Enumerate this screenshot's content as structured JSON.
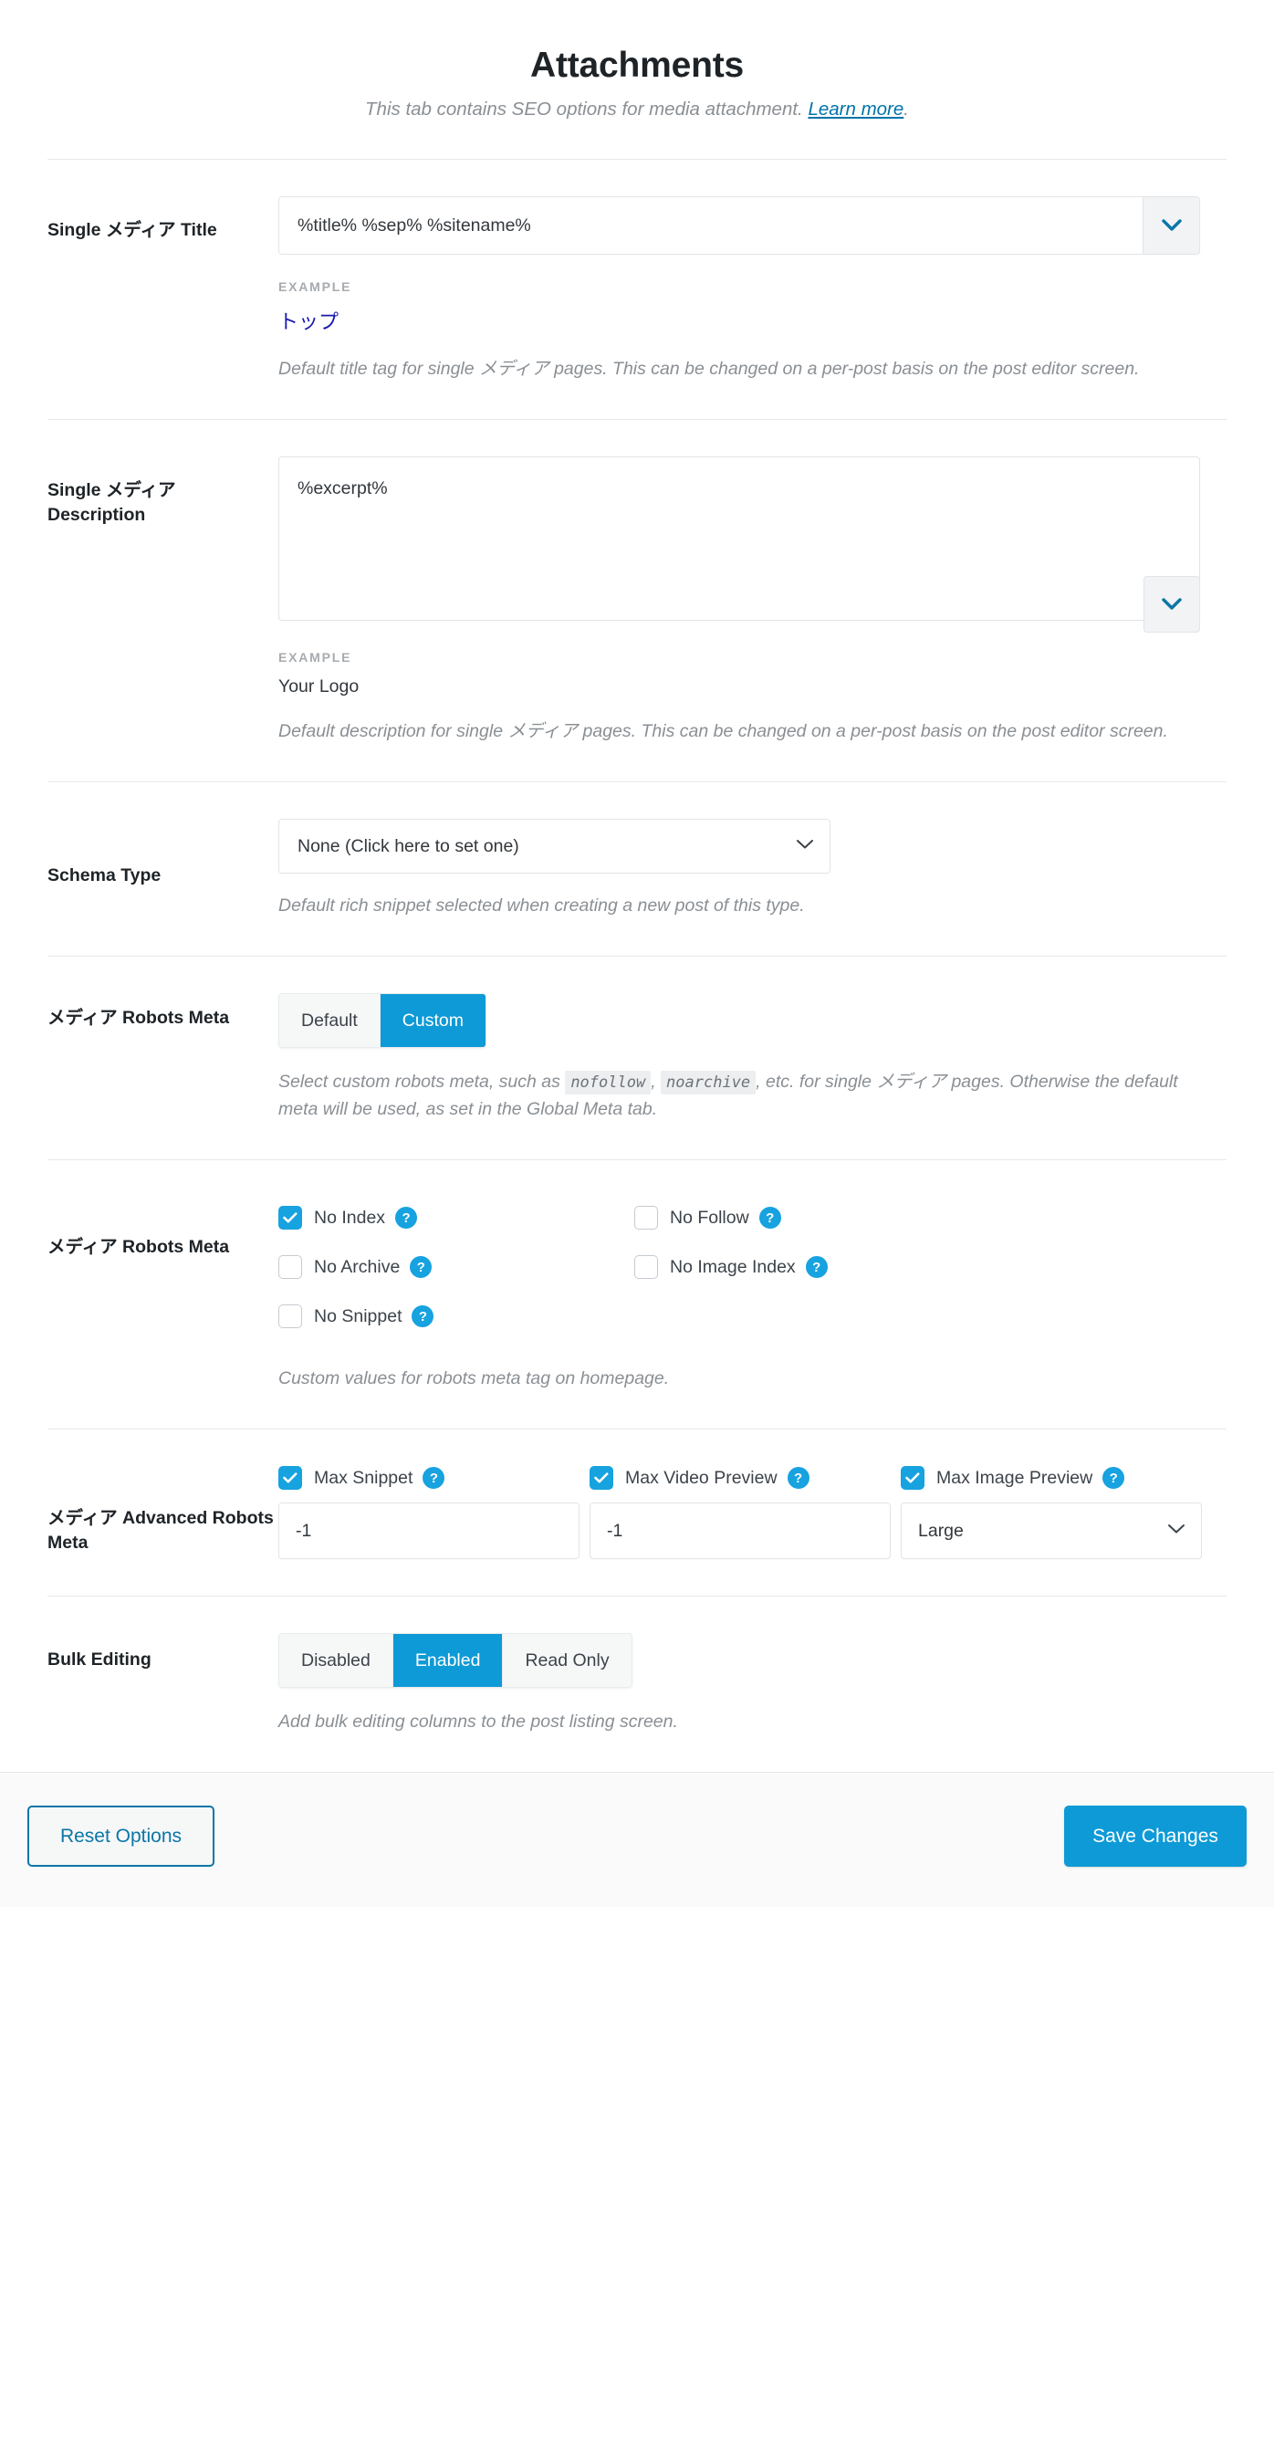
{
  "header": {
    "title": "Attachments",
    "subtitle_text": "This tab contains SEO options for media attachment.",
    "subtitle_link": "Learn more",
    "subtitle_period": "."
  },
  "colors": {
    "accent": "#0e9ad6",
    "checkbox_on": "#17a2e0",
    "link": "#0073aa",
    "example_value": "#1a1ab0",
    "muted_text": "#8a8f94"
  },
  "labels": {
    "example": "EXAMPLE"
  },
  "single_title": {
    "label": "Single メディア Title",
    "value": "%title% %sep% %sitename%",
    "example_value": "トップ",
    "help": "Default title tag for single メディア pages. This can be changed on a per-post basis on the post editor screen.",
    "toggle_icon": "chevron-down-icon"
  },
  "single_description": {
    "label": "Single メディア Description",
    "value": "%excerpt%",
    "example_value": "Your Logo",
    "help": "Default description for single メディア pages. This can be changed on a per-post basis on the post editor screen.",
    "toggle_icon": "chevron-down-icon"
  },
  "schema_type": {
    "label": "Schema Type",
    "selected": "None (Click here to set one)",
    "help": "Default rich snippet selected when creating a new post of this type."
  },
  "robots_meta_mode": {
    "label": "メディア Robots Meta",
    "options": [
      {
        "label": "Default",
        "active": false
      },
      {
        "label": "Custom",
        "active": true
      }
    ],
    "help_part1": "Select custom robots meta, such as ",
    "help_code1": "nofollow",
    "help_part2": ", ",
    "help_code2": "noarchive",
    "help_part3": ", etc. for single メディア pages. Otherwise the default meta will be used, as set in the Global Meta tab."
  },
  "robots_meta_checks": {
    "label": "メディア Robots Meta",
    "left_column": [
      {
        "label": "No Index",
        "checked": true,
        "help_icon": "question-mark-icon"
      },
      {
        "label": "No Archive",
        "checked": false,
        "help_icon": "question-mark-icon"
      },
      {
        "label": "No Snippet",
        "checked": false,
        "help_icon": "question-mark-icon"
      }
    ],
    "right_column": [
      {
        "label": "No Follow",
        "checked": false,
        "help_icon": "question-mark-icon"
      },
      {
        "label": "No Image Index",
        "checked": false,
        "help_icon": "question-mark-icon"
      }
    ],
    "help": "Custom values for robots meta tag on homepage.",
    "help_badge": "?"
  },
  "advanced_robots": {
    "label": "メディア Advanced Robots Meta",
    "fields": [
      {
        "label": "Max Snippet",
        "checked": true,
        "type": "number",
        "value": "-1"
      },
      {
        "label": "Max Video Preview",
        "checked": true,
        "type": "number",
        "value": "-1"
      },
      {
        "label": "Max Image Preview",
        "checked": true,
        "type": "select",
        "value": "Large"
      }
    ]
  },
  "bulk_editing": {
    "label": "Bulk Editing",
    "options": [
      {
        "label": "Disabled",
        "active": false
      },
      {
        "label": "Enabled",
        "active": true
      },
      {
        "label": "Read Only",
        "active": false
      }
    ],
    "help": "Add bulk editing columns to the post listing screen."
  },
  "footer": {
    "reset_label": "Reset Options",
    "save_label": "Save Changes"
  }
}
